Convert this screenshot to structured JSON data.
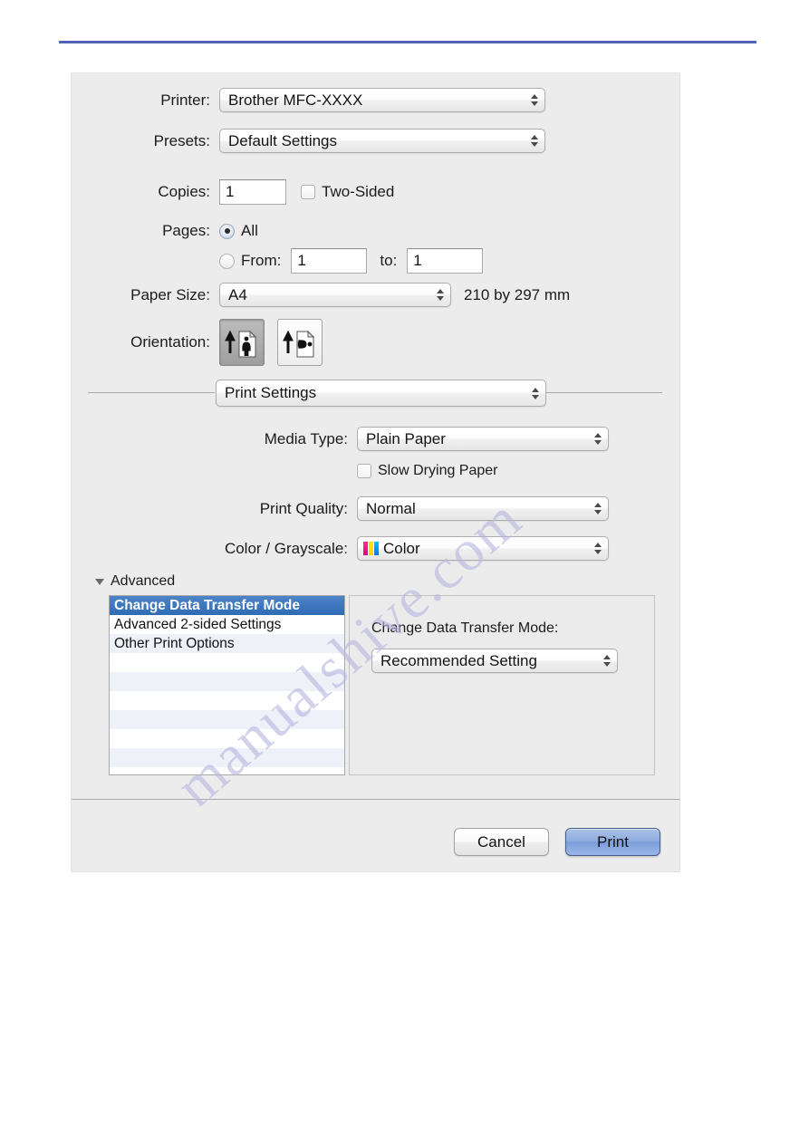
{
  "page": {
    "rule_color": "#4f63b5",
    "watermark_text": "manualshive.com"
  },
  "dialog": {
    "printer": {
      "label": "Printer:",
      "value": "Brother MFC-XXXX"
    },
    "presets": {
      "label": "Presets:",
      "value": "Default Settings"
    },
    "copies": {
      "label": "Copies:",
      "value": "1",
      "two_sided_label": "Two-Sided",
      "two_sided_checked": false
    },
    "pages": {
      "label": "Pages:",
      "all_label": "All",
      "all_selected": true,
      "from_label": "From:",
      "from_value": "1",
      "to_label": "to:",
      "to_value": "1"
    },
    "paper_size": {
      "label": "Paper Size:",
      "value": "A4",
      "dimensions": "210 by 297 mm"
    },
    "orientation": {
      "label": "Orientation:",
      "portrait_selected": true,
      "landscape_selected": false
    },
    "pane_popup": {
      "value": "Print Settings"
    },
    "media_type": {
      "label": "Media Type:",
      "value": "Plain Paper"
    },
    "slow_drying": {
      "label": "Slow Drying Paper",
      "checked": false
    },
    "print_quality": {
      "label": "Print Quality:",
      "value": "Normal"
    },
    "color_grayscale": {
      "label": "Color / Grayscale:",
      "value": "Color"
    },
    "advanced": {
      "label": "Advanced",
      "expanded": true,
      "items": [
        {
          "label": "Change Data Transfer Mode",
          "selected": true
        },
        {
          "label": "Advanced 2-sided Settings",
          "selected": false
        },
        {
          "label": "Other Print Options",
          "selected": false
        }
      ],
      "detail": {
        "title": "Change Data Transfer Mode:",
        "value": "Recommended Setting"
      },
      "selection_color": "#2f6bb4"
    },
    "buttons": {
      "cancel": "Cancel",
      "print": "Print"
    }
  }
}
